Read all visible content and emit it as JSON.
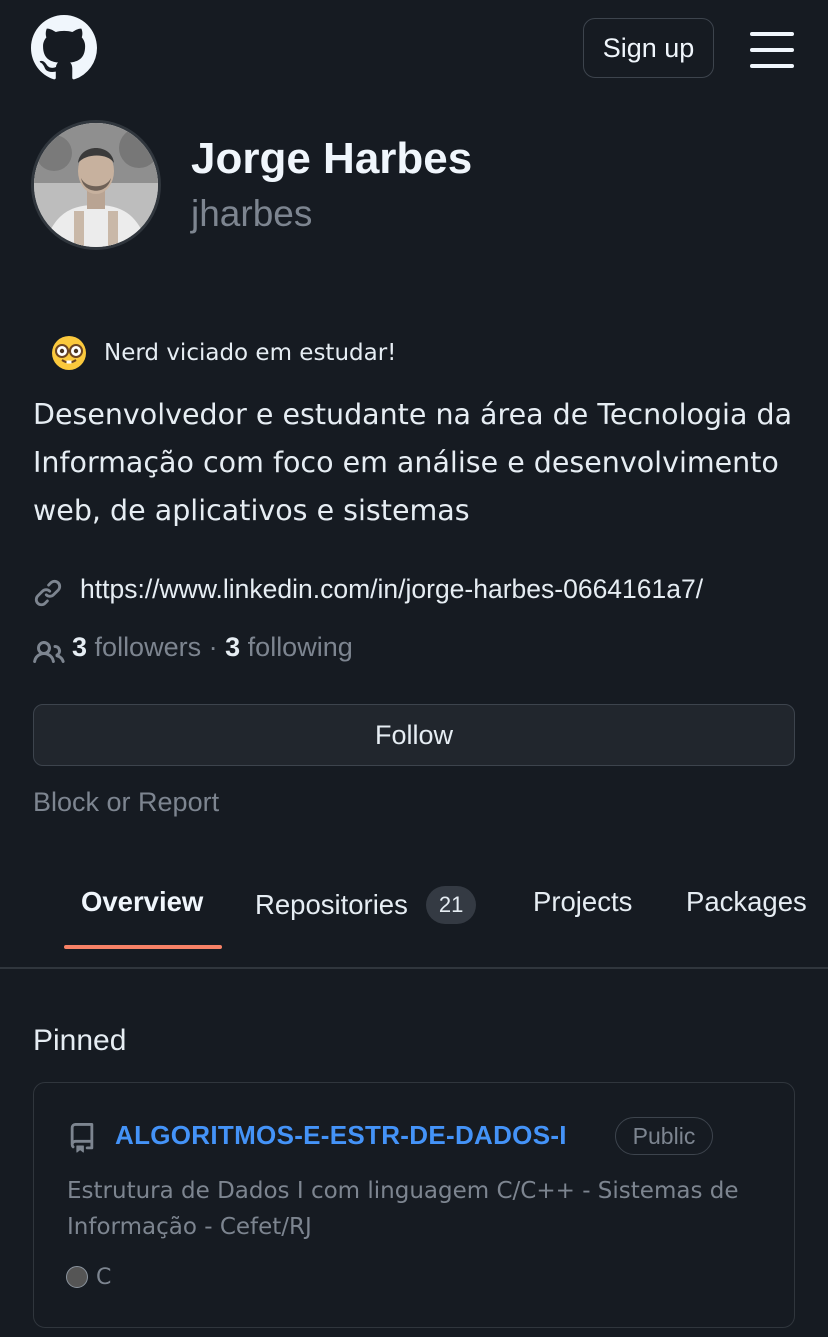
{
  "header": {
    "logo_icon": "github-octocat-icon",
    "signup_label": "Sign up",
    "menu_icon": "hamburger-menu-icon"
  },
  "profile": {
    "name": "Jorge Harbes",
    "username": "jharbes",
    "status_emoji": "nerd-face-emoji",
    "status_text": "Nerd viciado em estudar!",
    "bio": "Desenvolvedor e estudante na área de Tecnologia da Informação com foco em análise e desenvolvimento web, de aplicativos e sistemas",
    "website": "https://www.linkedin.com/in/jorge-harbes-0664161a7/",
    "followers_count": "3",
    "followers_label": "followers",
    "separator": "·",
    "following_count": "3",
    "following_label": "following",
    "follow_button": "Follow",
    "block_report": "Block or Report"
  },
  "tabs": [
    {
      "label": "Overview",
      "active": true
    },
    {
      "label": "Repositories",
      "count": "21"
    },
    {
      "label": "Projects"
    },
    {
      "label": "Packages"
    }
  ],
  "pinned": {
    "heading": "Pinned",
    "repos": [
      {
        "name": "ALGORITMOS-E-ESTR-DE-DADOS-I",
        "visibility": "Public",
        "description": "Estrutura de Dados I com linguagem C/C++ - Sistemas de Informação - Cefet/RJ",
        "language": "C",
        "language_color": "#555555"
      }
    ]
  },
  "colors": {
    "background": "#161b22",
    "link": "#4493f8",
    "tab_underline": "#f78166",
    "muted_text": "#7d8590"
  }
}
